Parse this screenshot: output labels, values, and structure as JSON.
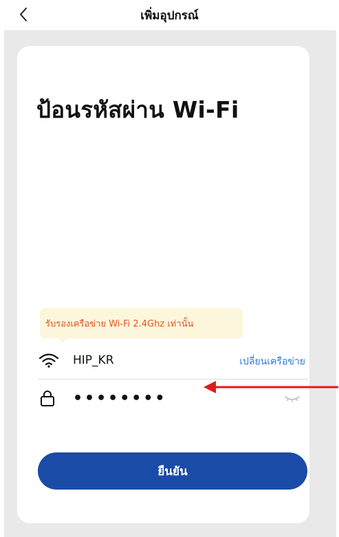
{
  "header": {
    "title": "เพิ่มอุปกรณ์"
  },
  "main": {
    "heading": "ป้อนรหัสผ่าน Wi-Fi",
    "tooltip": "รับรองเครือข่าย Wi-Fi 2.4Ghz เท่านั้น",
    "network": {
      "ssid": "HIP_KR",
      "change_label": "เปลี่ยนเครือข่าย"
    },
    "password": {
      "value": "12345678"
    },
    "confirm_label": "ยืนยัน"
  },
  "colors": {
    "primary_button": "#1a4ba6",
    "link": "#2c78d6",
    "tooltip_text": "#e2561e",
    "tooltip_bg": "#fcf6dc",
    "annotation_arrow": "#e11b1b"
  },
  "icons": [
    "chevron-left-icon",
    "wifi-icon",
    "lock-icon",
    "eye-closed-icon"
  ]
}
